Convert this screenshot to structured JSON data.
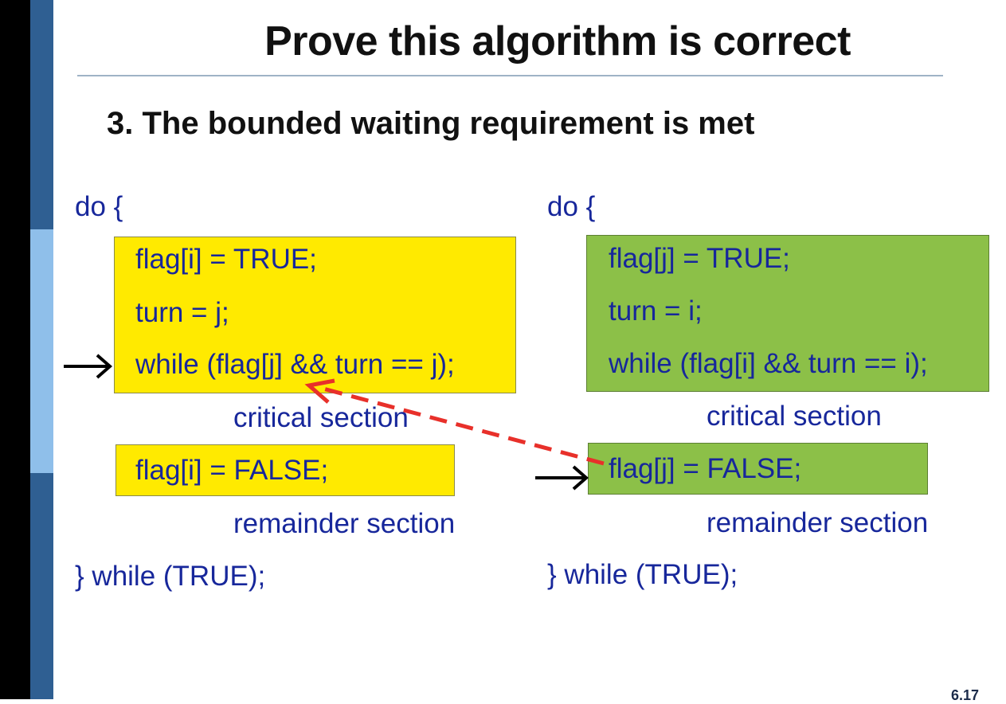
{
  "slide": {
    "title": "Prove this algorithm is correct",
    "subtitle": "3. The bounded waiting requirement is met",
    "page_number": "6.17"
  },
  "left_process": {
    "do_open": "do {",
    "entry_lines": [
      "flag[i] = TRUE;",
      "turn = j;",
      "while (flag[j] && turn == j);"
    ],
    "critical": "critical section",
    "exit_line": "flag[i] = FALSE;",
    "remainder": "remainder section",
    "loop_close": "} while (TRUE);"
  },
  "right_process": {
    "do_open": "do {",
    "entry_lines": [
      "flag[j] = TRUE;",
      "turn = i;",
      "while (flag[i] && turn == i);"
    ],
    "critical": "critical section",
    "exit_line": "flag[j] = FALSE;",
    "remainder": "remainder section",
    "loop_close": "} while (TRUE);"
  },
  "colors": {
    "code_text": "#17279b",
    "left_box": "#ffea00",
    "right_box": "#8cc048",
    "red_arrow": "#e8302a"
  },
  "icons": {
    "left_pointer": "right-arrow",
    "right_pointer": "right-arrow",
    "dependency": "dashed-red-arrow"
  }
}
